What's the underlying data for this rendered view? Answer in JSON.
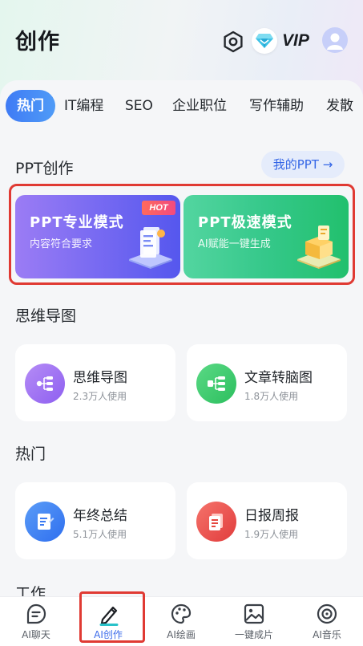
{
  "header": {
    "title": "创作",
    "vip_label": "VIP"
  },
  "tabs": [
    {
      "label": "热门",
      "active": true
    },
    {
      "label": "IT编程",
      "active": false
    },
    {
      "label": "SEO",
      "active": false
    },
    {
      "label": "企业职位",
      "active": false
    },
    {
      "label": "写作辅助",
      "active": false
    },
    {
      "label": "发散",
      "active": false
    }
  ],
  "ppt_section": {
    "title": "PPT创作",
    "my_ppt_label": "我的PPT →",
    "cards": [
      {
        "title": "PPT专业模式",
        "subtitle": "内容符合要求",
        "badge": "HOT"
      },
      {
        "title": "PPT极速模式",
        "subtitle": "AI赋能一键生成"
      }
    ]
  },
  "mindmap_section": {
    "title": "思维导图",
    "tools": [
      {
        "name": "思维导图",
        "usage": "2.3万人使用"
      },
      {
        "name": "文章转脑图",
        "usage": "1.8万人使用"
      }
    ]
  },
  "hot_section": {
    "title": "热门",
    "tools": [
      {
        "name": "年终总结",
        "usage": "5.1万人使用"
      },
      {
        "name": "日报周报",
        "usage": "1.9万人使用"
      }
    ]
  },
  "work_section": {
    "title": "工作"
  },
  "bottom_nav": [
    {
      "label": "AI聊天",
      "icon": "chat-icon"
    },
    {
      "label": "AI创作",
      "icon": "pen-icon",
      "active": true
    },
    {
      "label": "AI绘画",
      "icon": "palette-icon"
    },
    {
      "label": "一键成片",
      "icon": "image-icon"
    },
    {
      "label": "AI音乐",
      "icon": "music-disc-icon"
    }
  ],
  "colors": {
    "accent": "#3b6bea",
    "highlight_frame": "#e03a33",
    "ppt_pro": "#6a66f0",
    "ppt_fast": "#2ec47c"
  }
}
